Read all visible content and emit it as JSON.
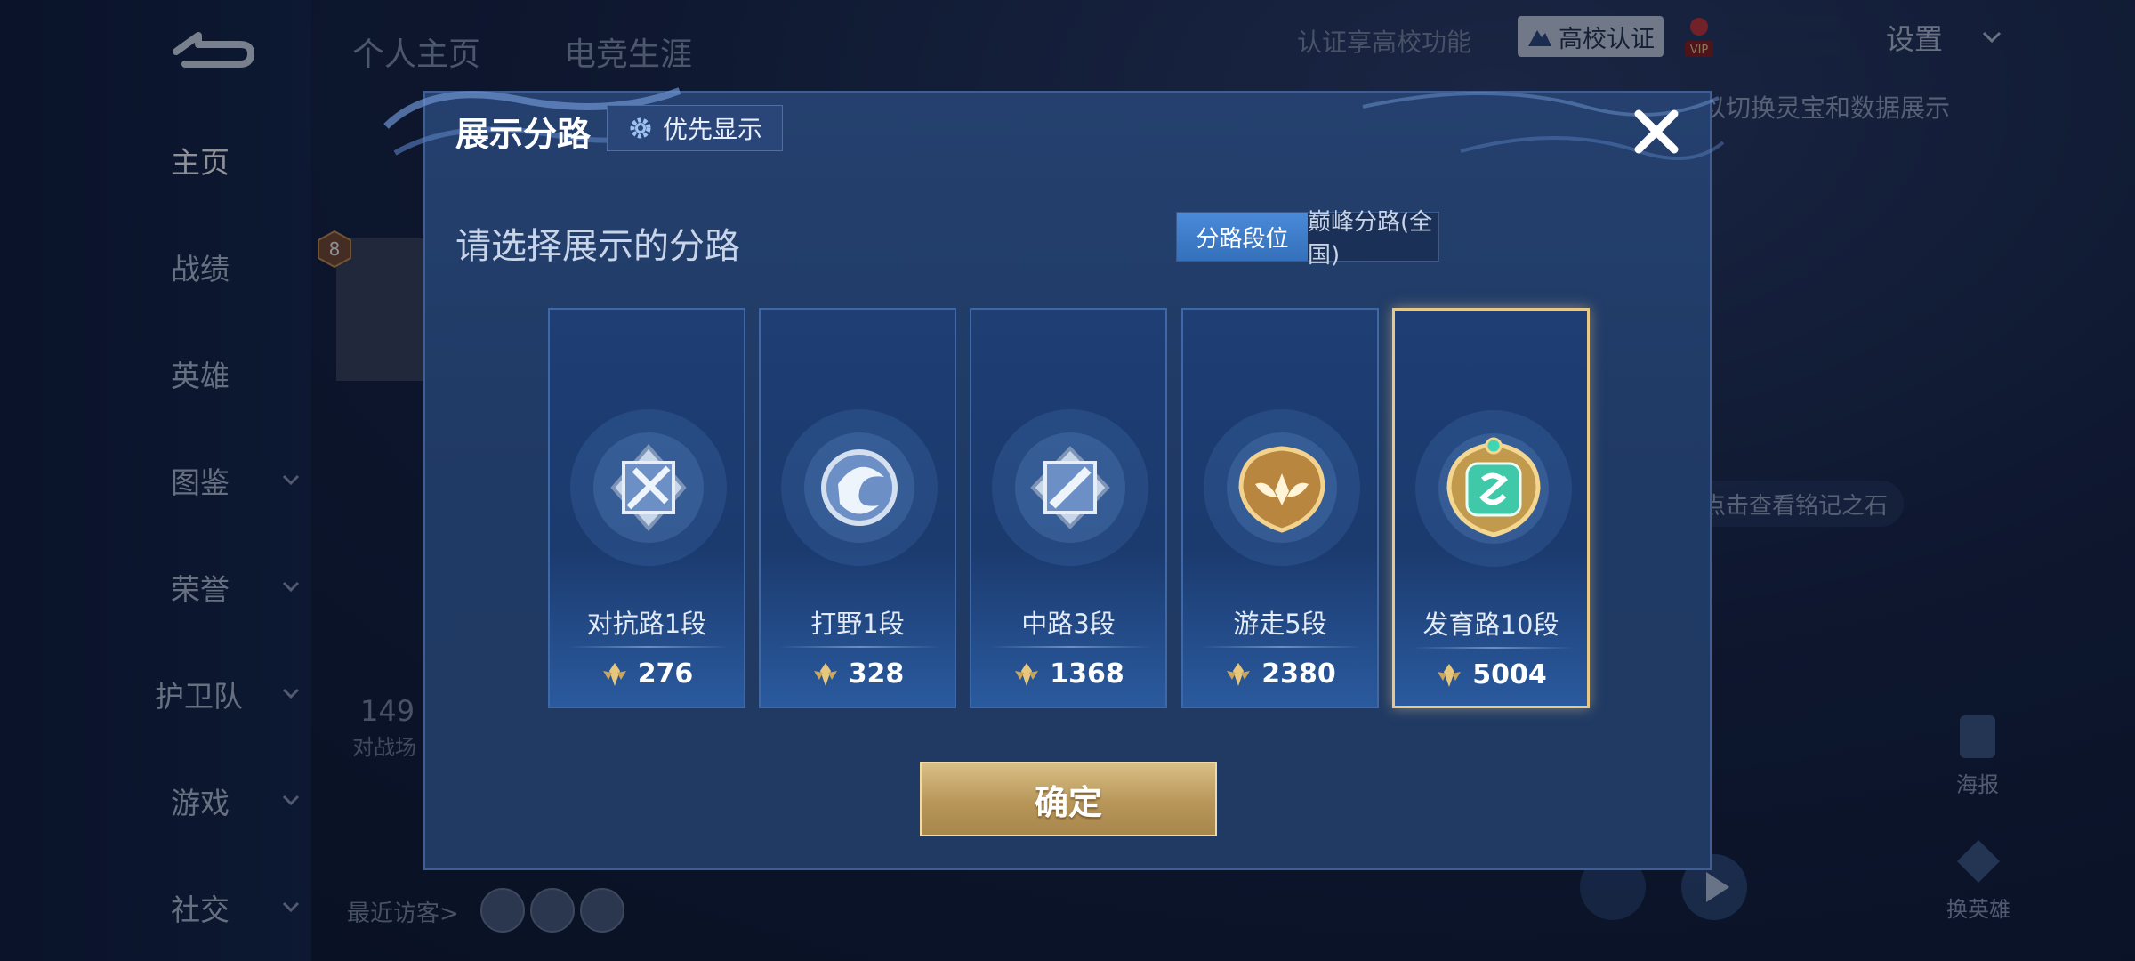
{
  "sidebar": {
    "items": [
      {
        "label": "主页",
        "active": true,
        "has_chevron": false
      },
      {
        "label": "战绩",
        "active": false,
        "has_chevron": false
      },
      {
        "label": "英雄",
        "active": false,
        "has_chevron": false
      },
      {
        "label": "图鉴",
        "active": false,
        "has_chevron": true
      },
      {
        "label": "荣誉",
        "active": false,
        "has_chevron": true
      },
      {
        "label": "护卫队",
        "active": false,
        "has_chevron": true
      },
      {
        "label": "游戏",
        "active": false,
        "has_chevron": true
      },
      {
        "label": "社交",
        "active": false,
        "has_chevron": true
      }
    ]
  },
  "header": {
    "tabs": [
      "个人主页",
      "电竞生涯"
    ],
    "cert_text": "认证享高校功能",
    "cert_badge": "高校认证",
    "vip_label": "VIP",
    "settings_label": "设置"
  },
  "background": {
    "hint_text": "以切换灵宝和数据展示",
    "stone_text": "点击查看铭记之石",
    "battle_count": "149",
    "battle_label": "对战场",
    "visitors_label": "最近访客>",
    "level": "8",
    "poster_label": "海报",
    "swap_hero_label": "换英雄"
  },
  "modal": {
    "title": "展示分路",
    "priority_label": "优先显示",
    "subtitle": "请选择展示的分路",
    "tabs": [
      {
        "label": "分路段位",
        "active": true
      },
      {
        "label": "巅峰分路(全国)",
        "active": false
      }
    ],
    "lanes": [
      {
        "name": "对抗路1段",
        "score": "276",
        "emblem": "silver-cross-swords",
        "selected": false
      },
      {
        "name": "打野1段",
        "score": "328",
        "emblem": "silver-swirl",
        "selected": false
      },
      {
        "name": "中路3段",
        "score": "1368",
        "emblem": "silver-staff",
        "selected": false
      },
      {
        "name": "游走5段",
        "score": "2380",
        "emblem": "gold-wings",
        "selected": false
      },
      {
        "name": "发育路10段",
        "score": "5004",
        "emblem": "gold-jade-bow",
        "selected": true
      }
    ],
    "confirm_label": "确定"
  },
  "colors": {
    "accent_blue": "#3a7cc8",
    "gold": "#c9a86a",
    "modal_bg": "#223d6a"
  }
}
